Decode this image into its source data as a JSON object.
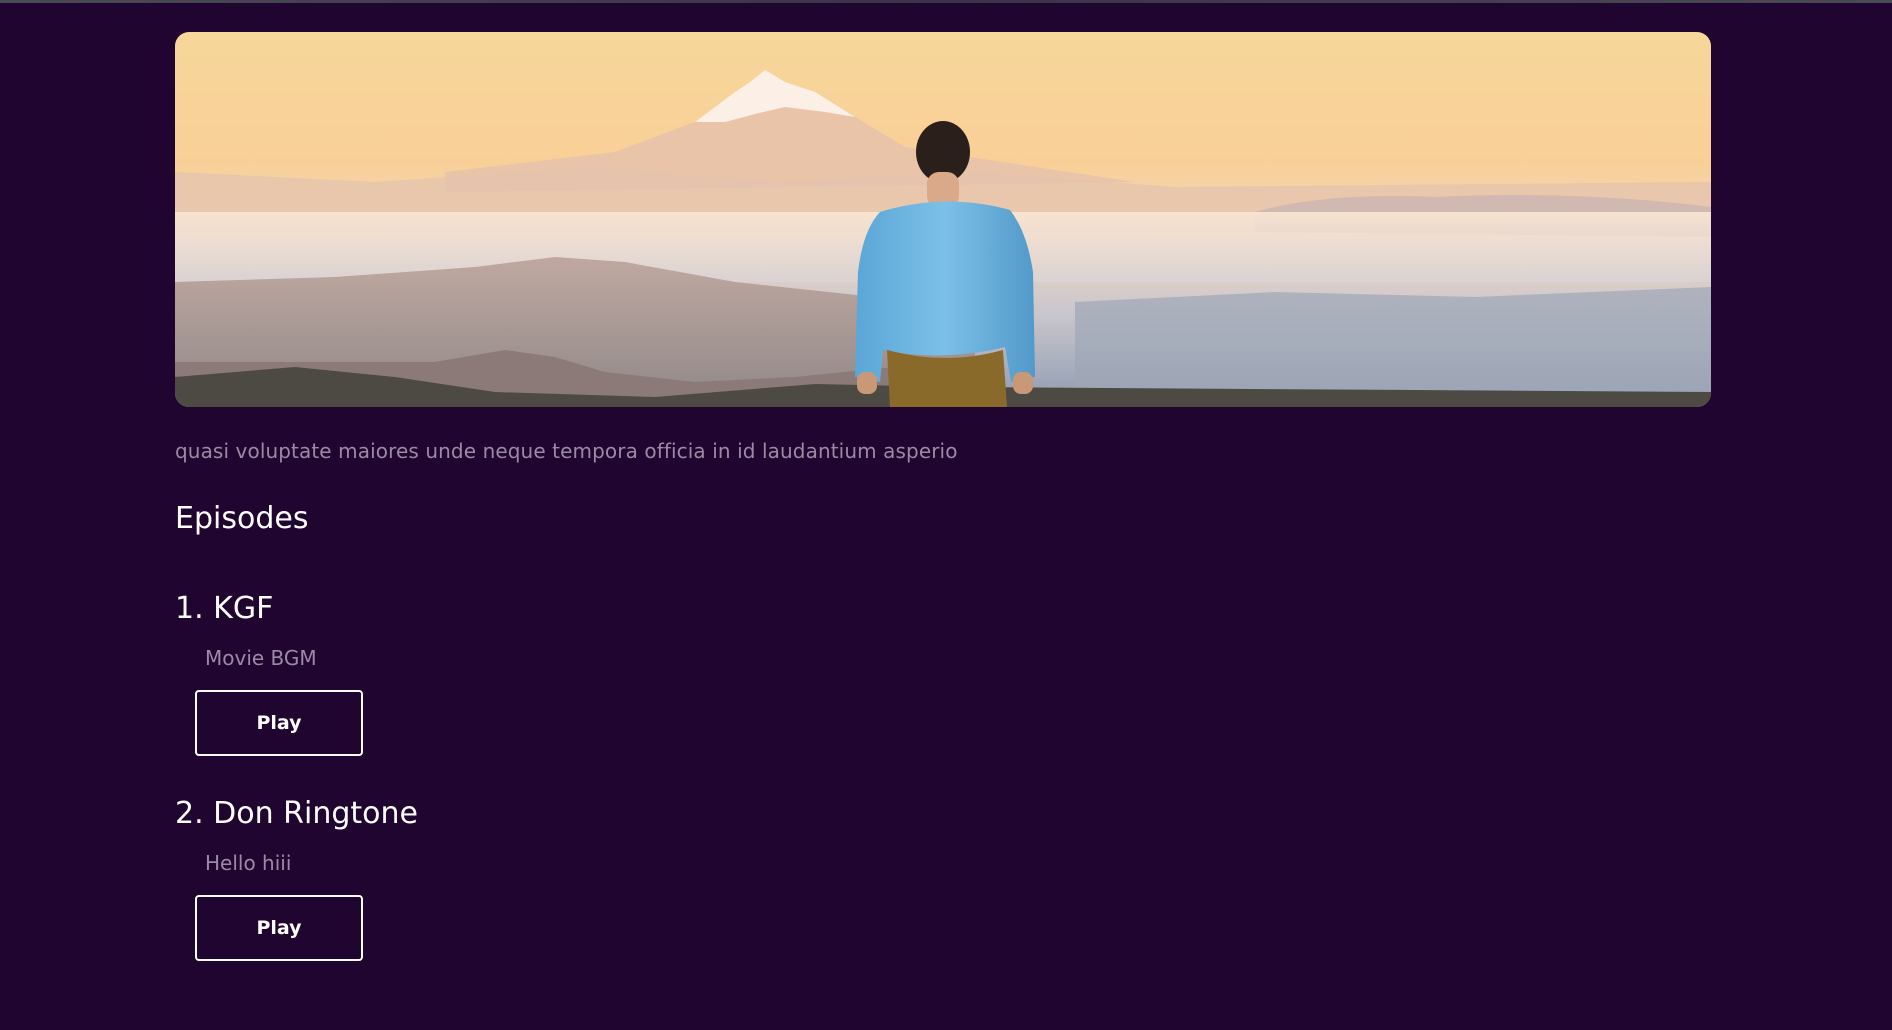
{
  "description": "quasi voluptate maiores unde neque tempora officia in id laudantium asperio",
  "episodes_heading": "Episodes",
  "episodes": [
    {
      "title": "1. KGF",
      "subtitle": "Movie BGM",
      "button_label": "Play"
    },
    {
      "title": "2. Don Ringtone",
      "subtitle": "Hello hiii",
      "button_label": "Play"
    }
  ],
  "colors": {
    "background": "#200530",
    "muted_text": "#9c8aa4",
    "primary_text": "#ffffff"
  }
}
